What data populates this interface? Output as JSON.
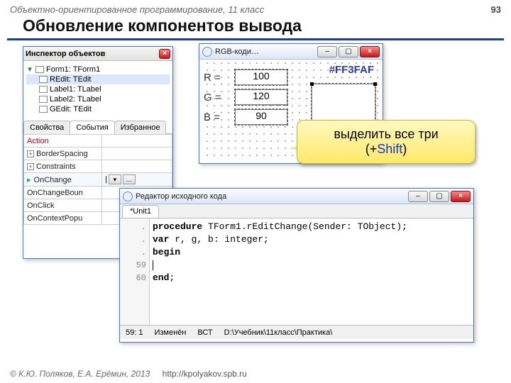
{
  "header": {
    "course": "Объектно-ориентированное программирование, 11 класс",
    "page": "93"
  },
  "title": "Обновление компонентов вывода",
  "footer": {
    "copy": "© К.Ю. Поляков, Е.А. Ерёмин, 2013",
    "url": "http://kpolyakov.spb.ru"
  },
  "inspector": {
    "title": "Инспектор объектов",
    "tree": [
      {
        "label": "Form1: TForm1",
        "expand": "▾",
        "level": 0
      },
      {
        "label": "REdit: TEdit",
        "level": 1,
        "selected": true
      },
      {
        "label": "Label1: TLabel",
        "level": 1
      },
      {
        "label": "Label2: TLabel",
        "level": 1
      },
      {
        "label": "GEdit: TEdit",
        "level": 1
      }
    ],
    "tabs": {
      "properties": "Свойства",
      "events": "События",
      "favorites": "Избранное"
    },
    "rows": [
      {
        "name": "Action",
        "value": "",
        "kind": "action"
      },
      {
        "name": "BorderSpacing",
        "value": "",
        "expand": "+"
      },
      {
        "name": "Constraints",
        "value": "",
        "expand": "+"
      },
      {
        "name": "OnChange",
        "value": "",
        "selected": true,
        "hasButtons": true
      },
      {
        "name": "OnChangeBoun",
        "value": ""
      },
      {
        "name": "OnClick",
        "value": ""
      },
      {
        "name": "OnContextPopu",
        "value": ""
      }
    ]
  },
  "rgb": {
    "title": "RGB-коди…",
    "labels": {
      "r": "R =",
      "g": "G =",
      "b": "B ="
    },
    "values": {
      "r": "100",
      "g": "120",
      "b": "90"
    },
    "hex": "#FF3FAF"
  },
  "callout": {
    "line1": "выделить все три",
    "line2_prefix": "(+",
    "shift": "Shift",
    "line2_suffix": ")"
  },
  "editor": {
    "title": "Редактор исходного кода",
    "tab": "*Unit1",
    "gutter": [
      ".",
      ".",
      ".",
      "59",
      "60"
    ],
    "code": {
      "l1_kw": "procedure",
      "l1_rest": " TForm1.rEditChange(Sender: TObject);",
      "l2_kw": "var",
      "l2_rest": " r, g, b: integer;",
      "l3_kw": "begin",
      "l4": "",
      "l5_kw": "end",
      "l5_rest": ";"
    },
    "status": {
      "pos": "59: 1",
      "state": "Изменён",
      "mode": "ВСТ",
      "path": "D:\\Учебник\\11класс\\Практика\\"
    }
  }
}
